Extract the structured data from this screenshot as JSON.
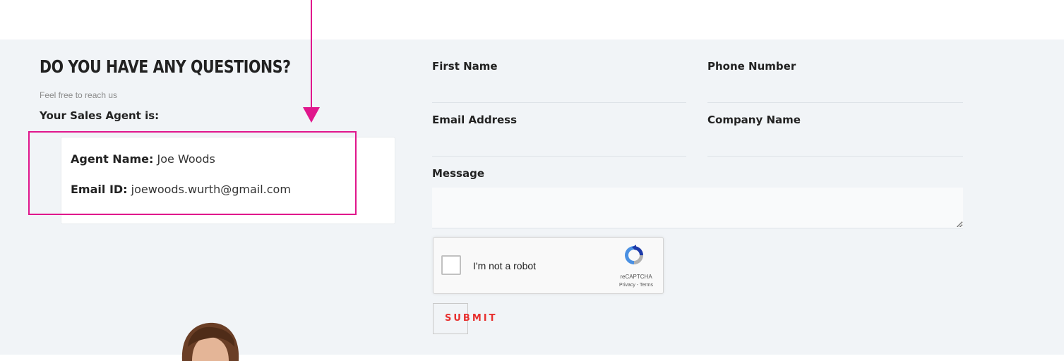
{
  "contact": {
    "heading": "DO YOU HAVE ANY QUESTIONS?",
    "subtext": "Feel free to reach us",
    "agent_section_label": "Your Sales Agent is:"
  },
  "agent": {
    "name_label": "Agent Name:",
    "name_value": "Joe Woods",
    "email_label": "Email ID:",
    "email_value": "joewoods.wurth@gmail.com"
  },
  "form": {
    "first_name_label": "First Name",
    "phone_label": "Phone Number",
    "email_label": "Email Address",
    "company_label": "Company Name",
    "message_label": "Message",
    "submit_label": "SUBMIT"
  },
  "recaptcha": {
    "label": "I'm not a robot",
    "brand": "reCAPTCHA",
    "links": "Privacy - Terms"
  },
  "colors": {
    "highlight": "#e0168c",
    "submit_text": "#e8302f",
    "section_bg": "#f1f4f7"
  },
  "icons": {
    "annotation": "arrow-down-icon",
    "recaptcha": "recaptcha-logo-icon"
  }
}
